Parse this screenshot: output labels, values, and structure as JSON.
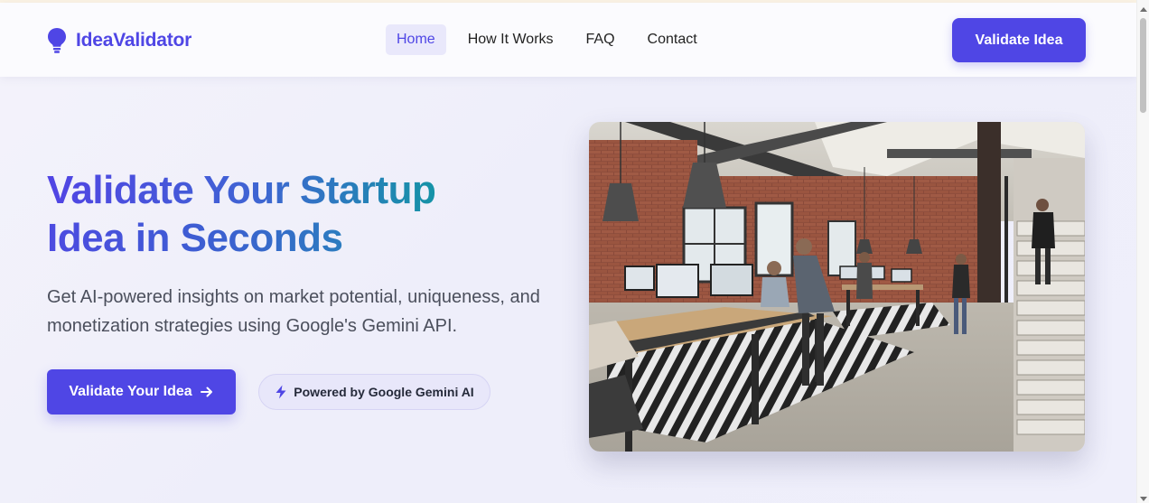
{
  "header": {
    "brand": "IdeaValidator",
    "nav": [
      {
        "label": "Home",
        "active": true
      },
      {
        "label": "How It Works",
        "active": false
      },
      {
        "label": "FAQ",
        "active": false
      },
      {
        "label": "Contact",
        "active": false
      }
    ],
    "cta_label": "Validate Idea"
  },
  "hero": {
    "title_line1": "Validate Your Startup",
    "title_line2": "Idea in Seconds",
    "subtitle": "Get AI-powered insights on market potential, uniqueness, and monetization strategies using Google's Gemini API.",
    "primary_button_label": "Validate Your Idea",
    "badge_label": "Powered by Google Gemini AI"
  },
  "icons": {
    "logo": "lightbulb-icon",
    "button_arrow": "arrow-right-icon",
    "badge": "lightning-bolt-icon"
  },
  "colors": {
    "brand": "#4f46e5",
    "gradient_teal": "#0f9aa0",
    "text_muted": "#4b4f5c",
    "badge_bg": "#e8e7fa"
  },
  "image": {
    "description": "open-plan office with brick walls, pendant lamps, desks and a staircase"
  }
}
